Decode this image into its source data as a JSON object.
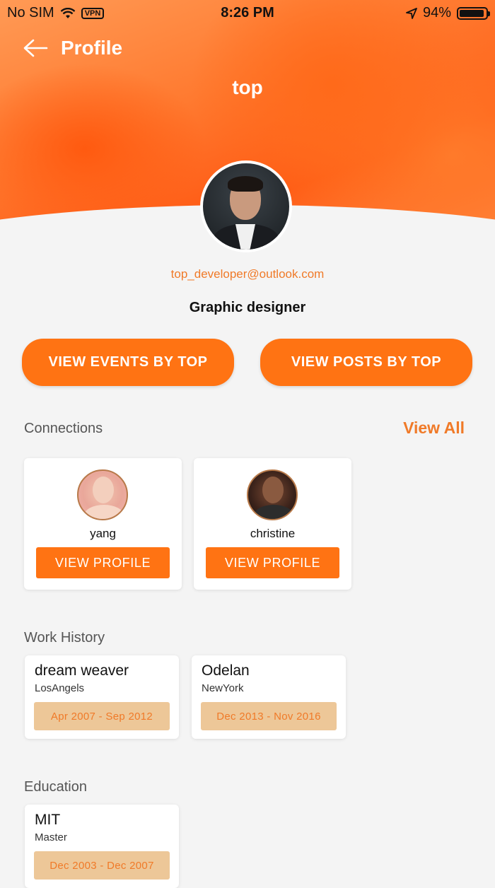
{
  "status_bar": {
    "carrier": "No SIM",
    "vpn": "VPN",
    "time": "8:26 PM",
    "battery": "94%",
    "battery_level": 0.94
  },
  "header": {
    "back_icon": "arrow-left-icon",
    "title": "Profile"
  },
  "profile": {
    "username": "top",
    "email": "top_developer@outlook.com",
    "role": "Graphic designer"
  },
  "actions": {
    "events_label": "VIEW EVENTS BY TOP",
    "posts_label": "VIEW POSTS BY TOP"
  },
  "connections": {
    "title": "Connections",
    "view_all": "View All",
    "items": [
      {
        "name": "yang",
        "button": "VIEW PROFILE"
      },
      {
        "name": "christine",
        "button": "VIEW PROFILE"
      }
    ]
  },
  "work_history": {
    "title": "Work History",
    "items": [
      {
        "company": "dream weaver",
        "location": "LosAngels",
        "dates": "Apr 2007 - Sep 2012"
      },
      {
        "company": "Odelan",
        "location": "NewYork",
        "dates": "Dec 2013 - Nov 2016"
      }
    ]
  },
  "education": {
    "title": "Education",
    "items": [
      {
        "school": "MIT",
        "degree": "Master",
        "dates": "Dec 2003 - Dec 2007"
      }
    ]
  },
  "colors": {
    "accent": "#ff7313",
    "accent_text": "#f07a28",
    "date_badge_bg": "#edc798",
    "background": "#f4f4f4"
  }
}
